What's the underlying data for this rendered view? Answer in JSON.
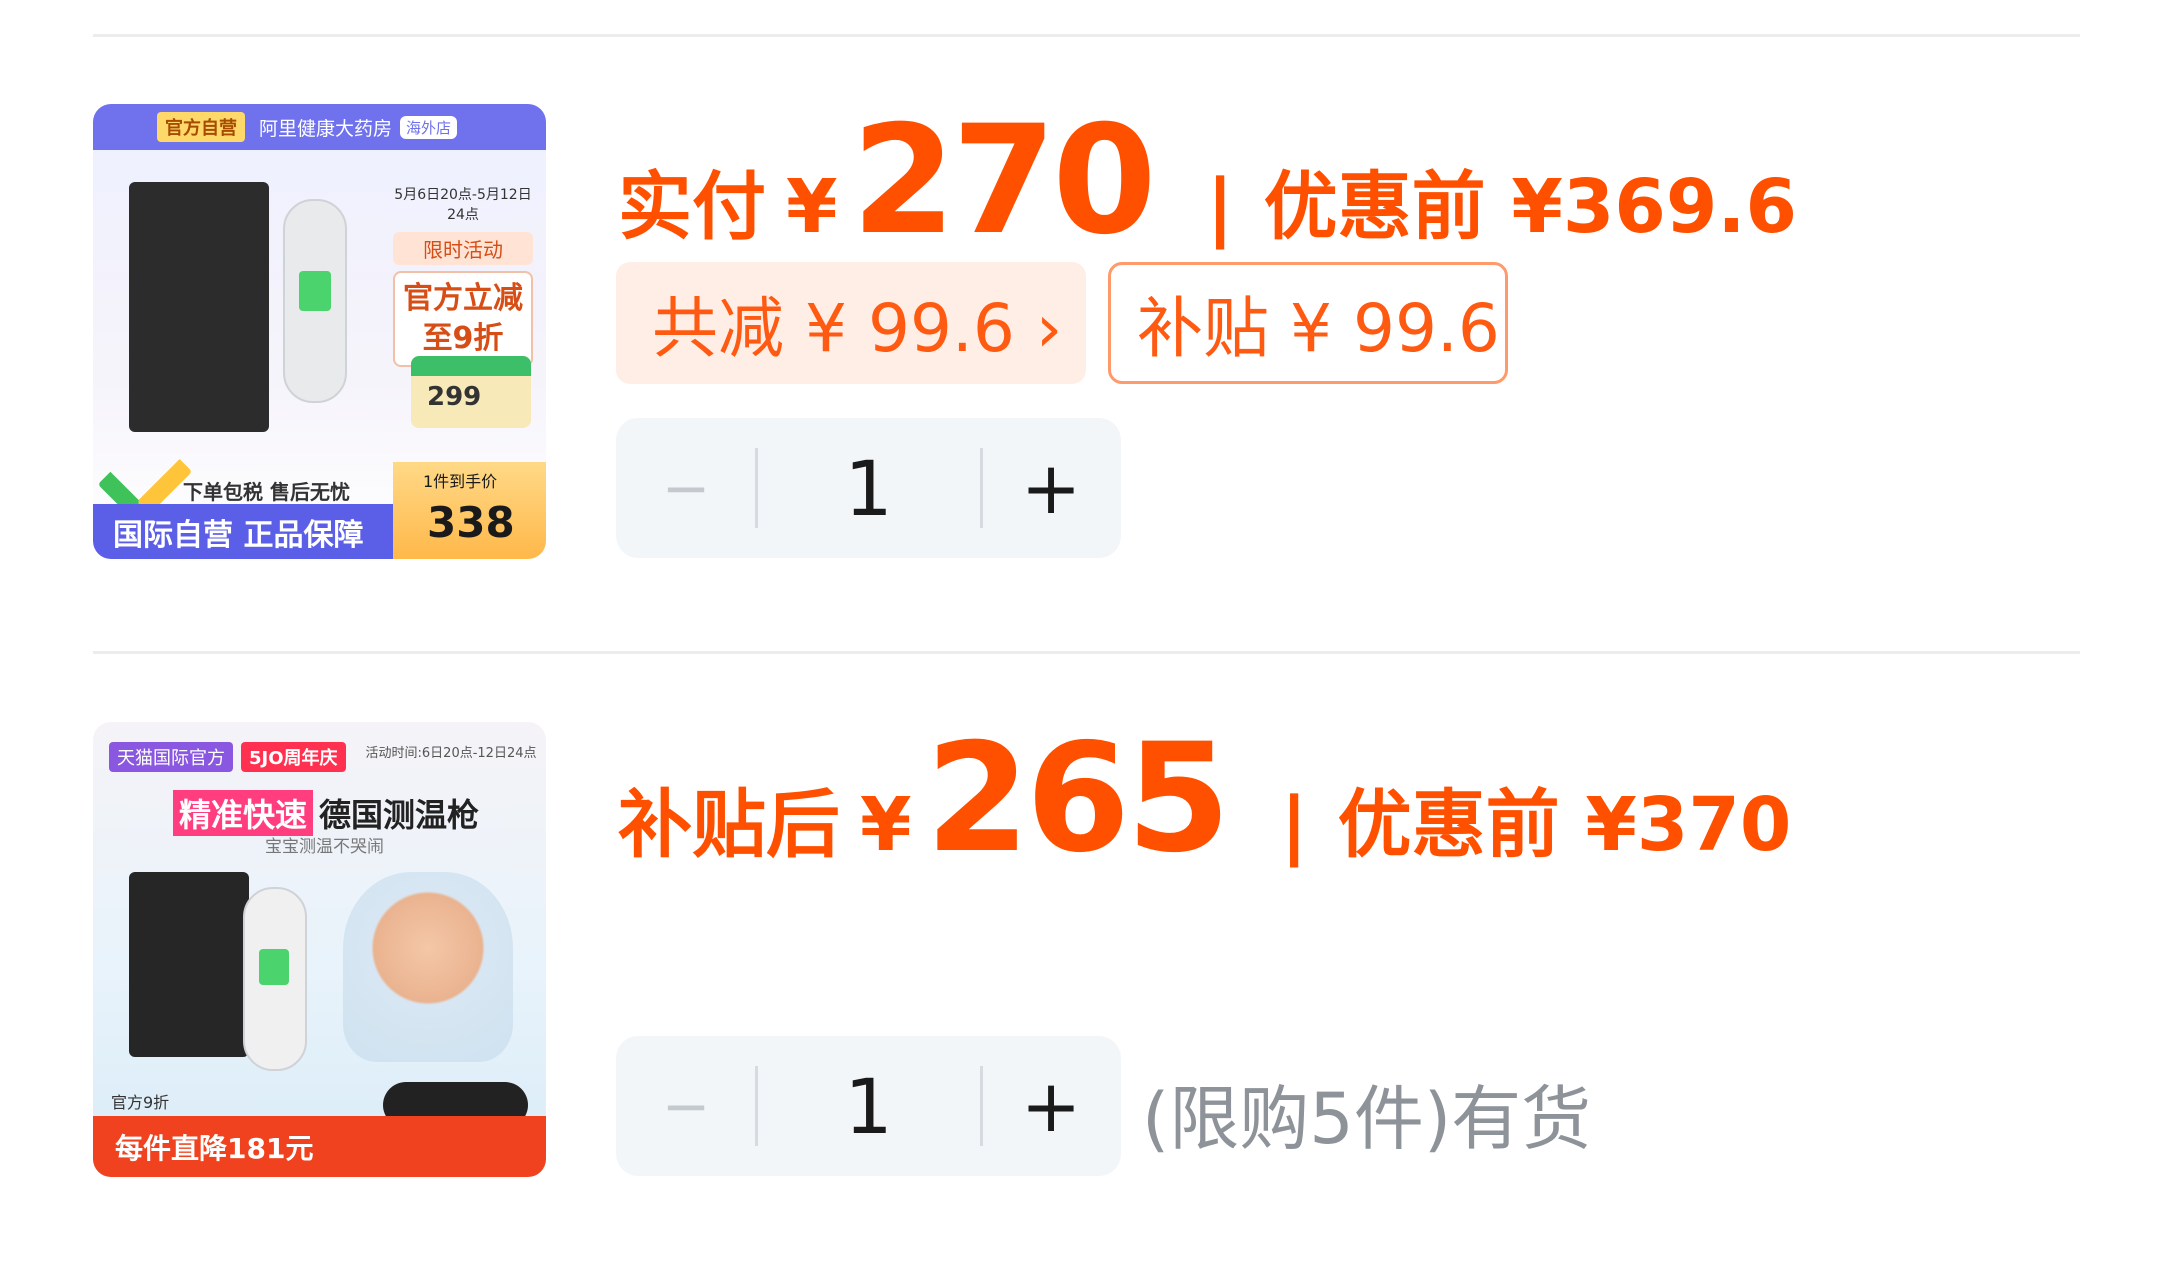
{
  "colors": {
    "accent": "#ff5000",
    "chip_bg": "#ffeee6",
    "chip_border": "#ff9a6a",
    "stepper_bg": "#f3f6f9",
    "muted": "#8e939a"
  },
  "items": [
    {
      "thumbnail": {
        "top_tag": "官方自营",
        "brand": "阿里健康大药房",
        "store_tag": "海外店",
        "promo_date": "5月6日20点-5月12日24点",
        "promo_title": "限时活动",
        "promo_deal_line1": "官方立减",
        "promo_deal_line2": "至9折",
        "card_value": "299",
        "mid_text": "下单包税 售后无忧",
        "bottom_text": "国际自营 正品保障",
        "price_caption": "1件到手价",
        "price_value": "338"
      },
      "price_label": "实付",
      "currency": "¥",
      "price_main": "270",
      "separator": "|",
      "original_price": "优惠前 ¥369.6",
      "chips": [
        {
          "text": "共减 ¥ 99.6 ›"
        },
        {
          "text": "补贴 ¥ 99.6"
        }
      ],
      "quantity": "1",
      "stepper": {
        "minus": "−",
        "plus": "+"
      }
    },
    {
      "thumbnail": {
        "tag_tmall": "天猫国际官方",
        "tag_anniv": "5JO周年庆",
        "promo_date": "活动时间:6日20点-12日24点",
        "headline_a": "精准快速",
        "headline_b": "德国测温枪",
        "subline": "宝宝测温不哭闹",
        "discount_note": "官方9折",
        "bottom_text": "每件直降181元"
      },
      "price_label": "补贴后",
      "currency": "¥",
      "price_main": "265",
      "separator": "|",
      "original_price": "优惠前 ¥370",
      "quantity": "1",
      "stepper": {
        "minus": "−",
        "plus": "+"
      },
      "stock_note": "(限购5件)有货"
    }
  ]
}
